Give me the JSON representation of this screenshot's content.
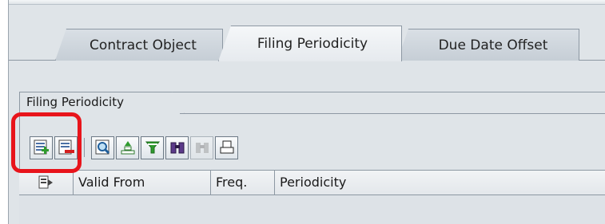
{
  "tabs": [
    {
      "label": "Contract Object"
    },
    {
      "label": "Filing Periodicity"
    },
    {
      "label": "Due Date Offset"
    }
  ],
  "group": {
    "title": "Filing Periodicity"
  },
  "toolbar": {
    "buttons": [
      {
        "icon": "insert-row-icon"
      },
      {
        "icon": "delete-row-icon"
      },
      {
        "icon": "details-icon"
      },
      {
        "icon": "sort-ascending-icon"
      },
      {
        "icon": "filter-icon"
      },
      {
        "icon": "find-icon"
      },
      {
        "icon": "find-next-icon",
        "disabled": true
      },
      {
        "icon": "print-icon"
      }
    ]
  },
  "table": {
    "columns": [
      "Valid From",
      "Freq.",
      "Periodicity"
    ]
  },
  "colors": {
    "highlight": "#e8141b",
    "background": "#dfe4e8"
  }
}
